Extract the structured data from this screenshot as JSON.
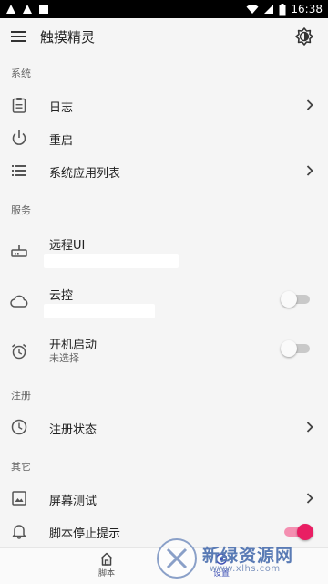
{
  "status_bar": {
    "time": "16:38"
  },
  "app_bar": {
    "title": "触摸精灵"
  },
  "sections": {
    "system": "系统",
    "service": "服务",
    "register": "注册",
    "other": "其它"
  },
  "rows": {
    "log": {
      "label": "日志"
    },
    "restart": {
      "label": "重启"
    },
    "sysapps": {
      "label": "系统应用列表"
    },
    "remote": {
      "label": "远程UI"
    },
    "cloud": {
      "label": "云控",
      "enabled": false
    },
    "autostart": {
      "label": "开机启动",
      "subtitle": "未选择",
      "enabled": false
    },
    "regstatus": {
      "label": "注册状态"
    },
    "screentest": {
      "label": "屏幕测试"
    },
    "stopnotice": {
      "label": "脚本停止提示",
      "enabled": true
    }
  },
  "bottom_nav": {
    "scripts_label": "脚本",
    "settings_label": "设置"
  },
  "watermark": {
    "text": "新绿资源网",
    "url": "www.xlhs.com"
  },
  "colors": {
    "accent": "#e91e63",
    "accent_track": "#f48fb1"
  }
}
